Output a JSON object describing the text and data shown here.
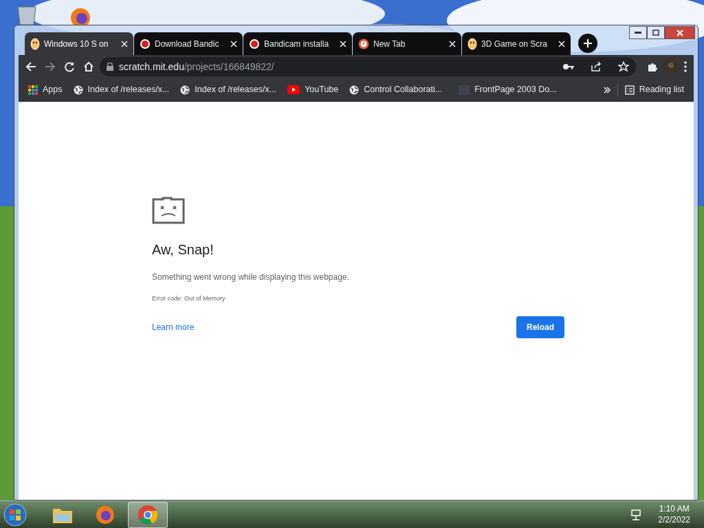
{
  "tabs": [
    {
      "label": "Windows 10 S on",
      "kind": "scratch",
      "selected": true
    },
    {
      "label": "Download Bandic",
      "kind": "record",
      "selected": false
    },
    {
      "label": "Bandicam installa",
      "kind": "record",
      "selected": false
    },
    {
      "label": "New Tab",
      "kind": "newtab",
      "selected": false
    },
    {
      "label": "3D Game on Scra",
      "kind": "scratch",
      "selected": false
    }
  ],
  "address": {
    "host": "scratch.mit.edu",
    "path": "/projects/166849822/"
  },
  "bookmarks": [
    {
      "label": "Apps",
      "kind": "apps"
    },
    {
      "label": "Index of /releases/x...",
      "kind": "globe"
    },
    {
      "label": "Index of /releases/x...",
      "kind": "globe"
    },
    {
      "label": "YouTube",
      "kind": "youtube"
    },
    {
      "label": "Control Collaborati...",
      "kind": "globe"
    },
    {
      "label": "FrontPage 2003 Do...",
      "kind": "blank"
    }
  ],
  "reading_list": "Reading list",
  "error": {
    "title": "Aw, Snap!",
    "message": "Something went wrong while displaying this webpage.",
    "code": "Error code: Out of Memory",
    "link": "Learn more",
    "button": "Reload"
  },
  "taskbar": {
    "items": [
      {
        "kind": "folder",
        "selected": false
      },
      {
        "kind": "firefox",
        "selected": false
      },
      {
        "kind": "chrome",
        "selected": true
      }
    ],
    "time": "1:10 AM",
    "date": "2/2/2022"
  }
}
